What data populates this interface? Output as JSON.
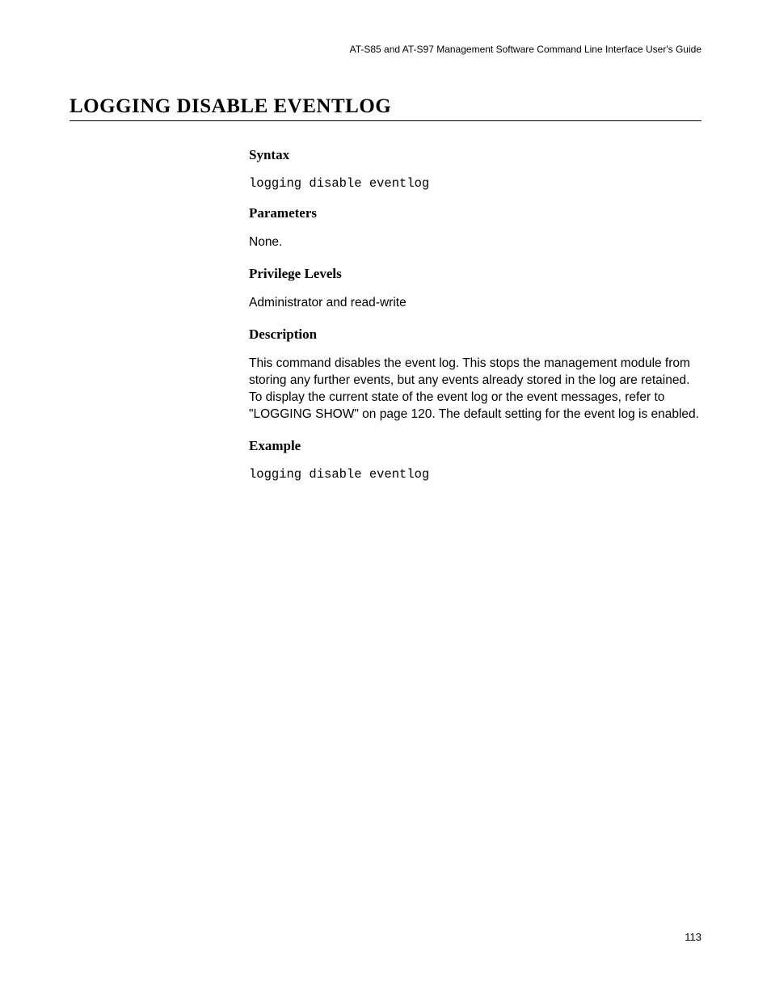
{
  "header": {
    "guide_title": "AT-S85 and AT-S97 Management Software Command Line Interface User's Guide"
  },
  "page": {
    "title": "LOGGING DISABLE EVENTLOG",
    "number": "113"
  },
  "sections": {
    "syntax": {
      "heading": "Syntax",
      "code": "logging disable eventlog"
    },
    "parameters": {
      "heading": "Parameters",
      "text": "None."
    },
    "privilege": {
      "heading": "Privilege Levels",
      "text": "Administrator and read-write"
    },
    "description": {
      "heading": "Description",
      "text": "This command disables the event log. This stops the management module from storing any further events, but any events already stored in the log are retained. To display the current state of the event log or the event messages, refer to \"LOGGING SHOW\" on page 120. The default setting for the event log is enabled."
    },
    "example": {
      "heading": "Example",
      "code": "logging disable eventlog"
    }
  }
}
